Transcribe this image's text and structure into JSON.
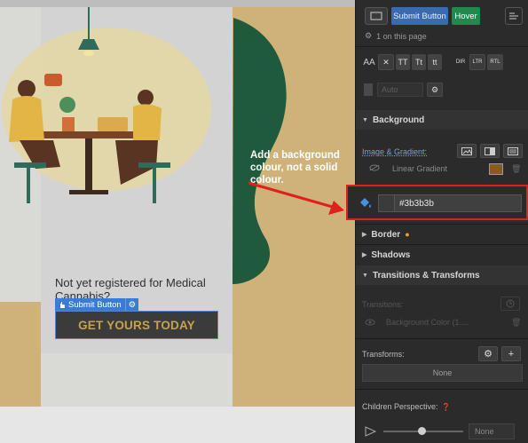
{
  "canvas": {
    "question_text": "Not yet registered for Medical Cannabis?",
    "selected_tag": {
      "label": "Submit Button"
    },
    "cta_label": "GET YOURS TODAY",
    "note_text": "Add a background colour, not a solid colour."
  },
  "panel": {
    "state": {
      "class_chip": "Submit Button",
      "state_chip": "Hover"
    },
    "on_page": "1 on this page",
    "typography": {
      "aa": "AA",
      "x": "✕",
      "tt": "TT",
      "tt_cap": "Tt",
      "tt_low": "tt",
      "dir": "DIR",
      "ltr": "LTR",
      "rtl": "RTL"
    },
    "auto_placeholder": "Auto",
    "background": {
      "title": "Background",
      "image_gradient_label": "Image & Gradient:",
      "gradient_label": "Linear Gradient",
      "color_hex": "#3b3b3b"
    },
    "border_title": "Border",
    "border_dot": "●",
    "shadows_title": "Shadows",
    "transitions": {
      "title": "Transitions & Transforms",
      "transitions_label": "Transitions:",
      "bg_color_item": "Background Color (1....",
      "transforms_label": "Transforms:",
      "none_label": "None",
      "children_label": "Children Perspective:",
      "perspective_value": "None"
    }
  },
  "colors": {
    "gold": "#cfb27a",
    "button_bg": "#3b3b3b",
    "button_text": "#c8a14e",
    "panel_bg": "#2b2b2b",
    "annotation_red": "#e0211b",
    "hover_green": "#1f8a4c",
    "selection_blue": "#3a7bd5"
  }
}
